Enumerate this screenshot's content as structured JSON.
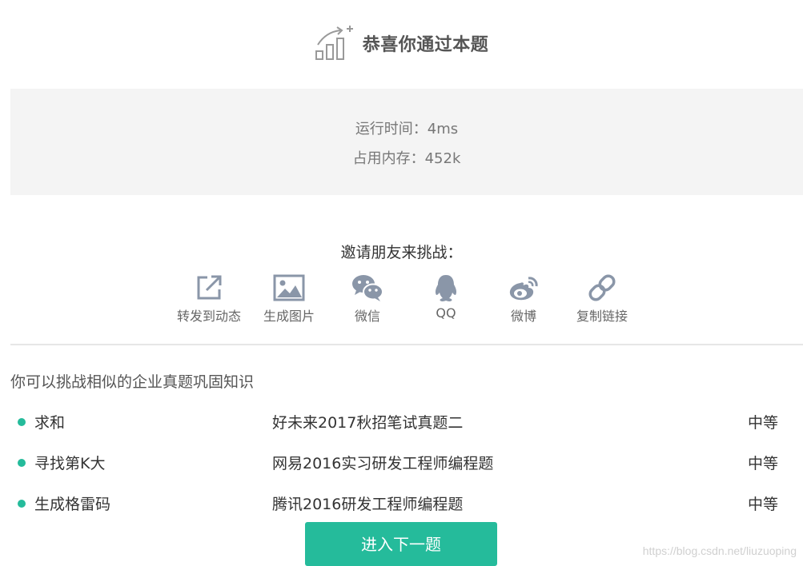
{
  "header": {
    "title": "恭喜你通过本题",
    "icon": "trophy-chart-icon"
  },
  "result": {
    "runtime_text": "运行时间：4ms",
    "memory_text": "占用内存：452k"
  },
  "share": {
    "title": "邀请朋友来挑战：",
    "items": [
      {
        "label": "转发到动态",
        "icon": "share-forward-icon"
      },
      {
        "label": "生成图片",
        "icon": "image-icon"
      },
      {
        "label": "微信",
        "icon": "wechat-icon"
      },
      {
        "label": "QQ",
        "icon": "qq-icon"
      },
      {
        "label": "微博",
        "icon": "weibo-icon"
      },
      {
        "label": "复制链接",
        "icon": "link-icon"
      }
    ]
  },
  "similar": {
    "title": "你可以挑战相似的企业真题巩固知识",
    "problems": [
      {
        "name": "求和",
        "source": "好未来2017秋招笔试真题二",
        "level": "中等"
      },
      {
        "name": "寻找第K大",
        "source": "网易2016实习研发工程师编程题",
        "level": "中等"
      },
      {
        "name": "生成格雷码",
        "source": "腾讯2016研发工程师编程题",
        "level": "中等"
      }
    ]
  },
  "next_button": {
    "label": "进入下一题"
  },
  "watermark": "https://blog.csdn.net/liuzuoping",
  "colors": {
    "accent": "#25bb9b",
    "icon": "#8a96a8",
    "panel": "#f4f4f4"
  }
}
